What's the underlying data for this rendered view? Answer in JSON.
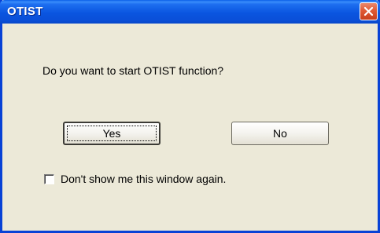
{
  "window": {
    "title": "OTIST",
    "close_icon": "close-x-icon",
    "accent_color": "#0a55e0",
    "close_color": "#e05a35"
  },
  "dialog": {
    "message": "Do you want to start OTIST function?",
    "yes_label": "Yes",
    "no_label": "No",
    "checkbox_label": "Don't show me this window again.",
    "checkbox_checked": false
  }
}
